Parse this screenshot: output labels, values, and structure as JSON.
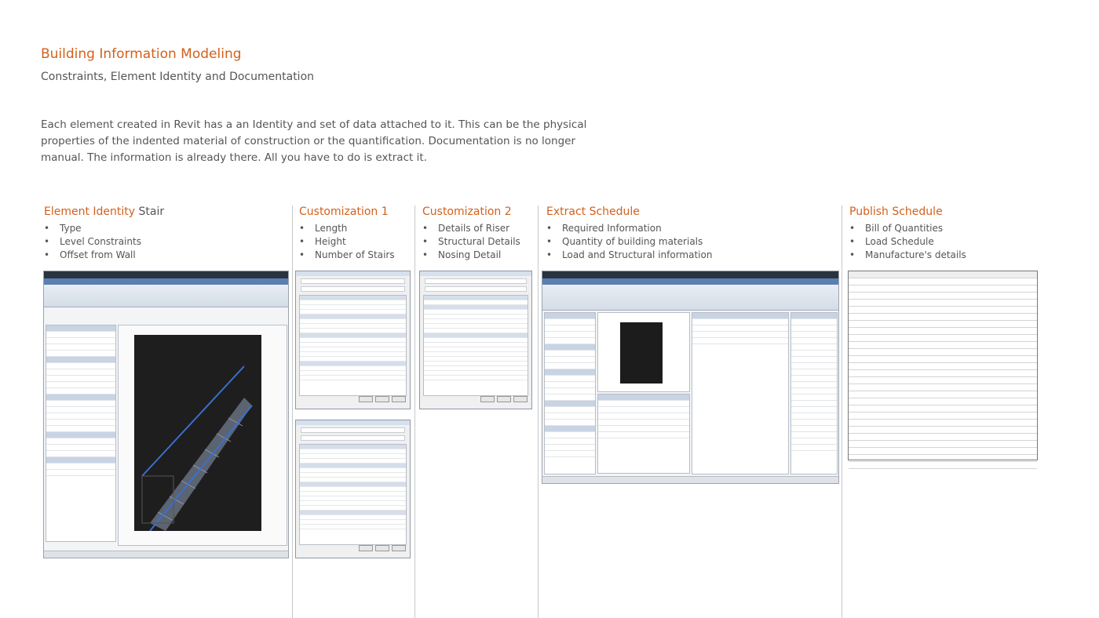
{
  "header": {
    "title": "Building Information Modeling",
    "subtitle": "Constraints, Element Identity and Documentation",
    "intro": "Each element created in Revit has a an Identity and set of data attached to it. This can be the physical properties of the indented material of construction or the quantification. Documentation is no longer manual. The information is already there. All you have to do is extract it."
  },
  "columns": [
    {
      "title": "Element Identity",
      "title_rest": " Stair",
      "items": [
        "Type",
        "Level Constraints",
        "Offset from Wall"
      ]
    },
    {
      "title": "Customization 1",
      "items": [
        "Length",
        "Height",
        "Number of Stairs"
      ]
    },
    {
      "title": "Customization 2",
      "items": [
        "Details of Riser",
        "Structural Details",
        "Nosing Detail"
      ]
    },
    {
      "title": "Extract Schedule",
      "items": [
        "Required Information",
        "Quantity of building materials",
        "Load and Structural information"
      ]
    },
    {
      "title": "Publish Schedule",
      "items": [
        "Bill of Quantities",
        "Load Schedule",
        "Manufacture's details"
      ]
    }
  ],
  "colors": {
    "accent": "#d3601a",
    "text": "#555555"
  }
}
